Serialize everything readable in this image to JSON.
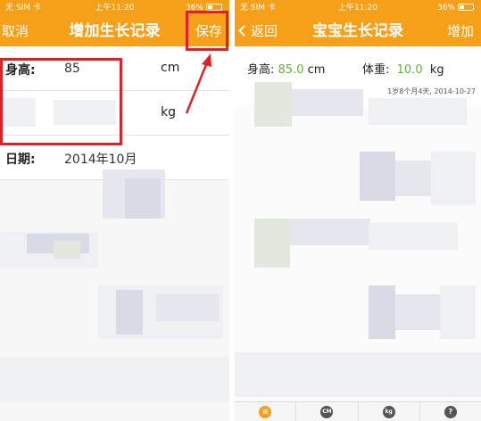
{
  "statusbar": {
    "carrier": "无 SIM 卡",
    "time": "上午11:20",
    "battery": "36%"
  },
  "left_screen": {
    "nav": {
      "cancel_label": "取消",
      "title": "增加生长记录",
      "save_label": "保存"
    },
    "form": {
      "height_label": "身高:",
      "height_value": "85",
      "height_unit": "cm",
      "weight_unit": "kg",
      "date_label": "日期:",
      "date_value": "2014年10月"
    }
  },
  "right_screen": {
    "nav": {
      "back_label": "返回",
      "title": "宝宝生长记录",
      "add_label": "增加"
    },
    "summary": {
      "height_label": "身高:",
      "height_value": "85.0",
      "height_unit": "cm",
      "weight_label": "体重:",
      "weight_value": "10.0",
      "weight_unit": "kg",
      "age_date": "1岁8个月4天, 2014-10-27"
    },
    "tabbar": [
      {
        "icon": "list-icon",
        "glyph": "≡",
        "active": true
      },
      {
        "icon": "height-chart-icon",
        "glyph": "CM",
        "active": false
      },
      {
        "icon": "weight-chart-icon",
        "glyph": "kg",
        "active": false
      },
      {
        "icon": "help-icon",
        "glyph": "?",
        "active": false
      }
    ]
  },
  "colors": {
    "accent": "#f5a018",
    "highlight_red": "#e01f26",
    "value_green": "#5cb531"
  }
}
